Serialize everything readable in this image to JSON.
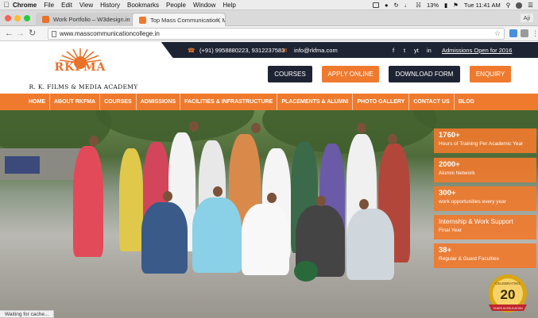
{
  "menubar": {
    "app": "Chrome",
    "items": [
      "File",
      "Edit",
      "View",
      "History",
      "Bookmarks",
      "People",
      "Window",
      "Help"
    ],
    "battery": "13%",
    "time": "Tue 11:41 AM"
  },
  "tabs": [
    {
      "title": "Work Portfolio – W3design.in",
      "active": false
    },
    {
      "title": "Top Mass Communication, Me",
      "active": true
    }
  ],
  "profile": "Aji",
  "address": {
    "url": "www.masscommunicationcollege.in"
  },
  "site": {
    "topbar": {
      "phone": "(+91) 9958880223, 9312237583",
      "email": "info@rkfma.com",
      "social": [
        "f",
        "t",
        "yt",
        "in"
      ],
      "admissions": "Admissions Open for 2016"
    },
    "logo": {
      "name": "RKFMA",
      "subtitle": "R. K. FILMS & MEDIA ACADEMY"
    },
    "buttons": [
      {
        "label": "COURSES",
        "color": "#1e2433"
      },
      {
        "label": "APPLY ONLINE",
        "color": "#ef7a2e"
      },
      {
        "label": "DOWNLOAD FORM",
        "color": "#1e2433"
      },
      {
        "label": "ENQUIRY",
        "color": "#ef7a2e"
      }
    ],
    "nav": [
      "HOME",
      "ABOUT RKFMA",
      "COURSES",
      "ADMISSIONS",
      "FACILITIES & INFRASTRUCTURE",
      "PLACEMENTS & ALUMNI",
      "PHOTO GALLERY",
      "CONTACT US",
      "BLOG"
    ],
    "stats": [
      {
        "value": "1760+",
        "label": "Hours of Training Per Academic Year"
      },
      {
        "value": "2000+",
        "label": "Alumni Network"
      },
      {
        "value": "300+",
        "label": "work opportunities every year"
      },
      {
        "value": "Internship & Work Support",
        "label": "Final Year"
      },
      {
        "value": "38+",
        "label": "Regular & Guest Faculties"
      }
    ],
    "badge": {
      "top": "CELEBRATING",
      "number": "20",
      "bottom": "YEARS IN EDUCATION"
    }
  },
  "status_text": "Waiting for cache...",
  "colors": {
    "accent": "#ef7a2e",
    "dark": "#1e2433"
  }
}
